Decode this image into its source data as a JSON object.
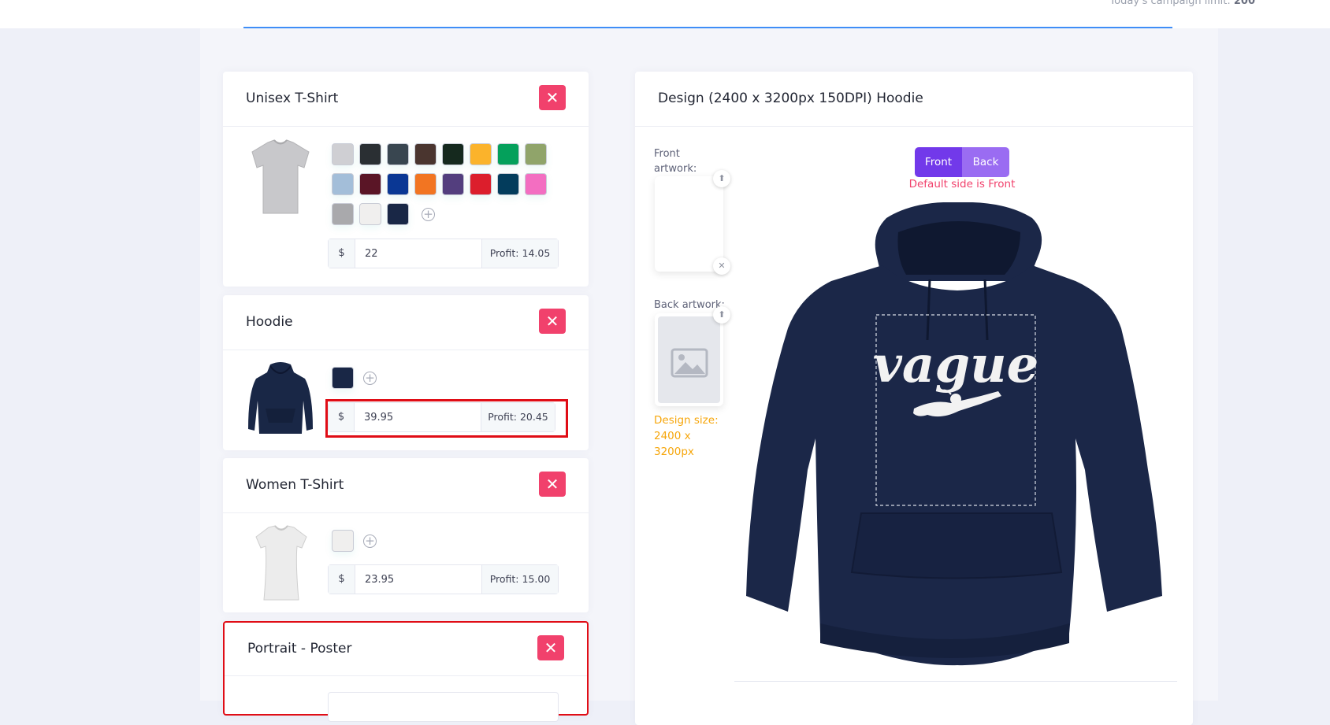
{
  "header": {
    "campaign_limit_label": "Today's campaign limit:",
    "campaign_limit_value": "200"
  },
  "products": [
    {
      "title": "Unisex T-Shirt",
      "currency": "$",
      "price": "22",
      "profit": "Profit: 14.05",
      "colors": [
        "#cfcfd3",
        "#2a2f33",
        "#394650",
        "#4a352f",
        "#15291e",
        "#fbb32b",
        "#04a05b",
        "#90a46a",
        "#a3bed9",
        "#5a1526",
        "#0a3794",
        "#f27522",
        "#533e7e",
        "#dc1e2c",
        "#033c5c",
        "#f36ec1",
        "#a9a9ac",
        "#f0efee",
        "#192746"
      ]
    },
    {
      "title": "Hoodie",
      "currency": "$",
      "price": "39.95",
      "profit": "Profit: 20.45",
      "colors": [
        "#192746"
      ]
    },
    {
      "title": "Women T-Shirt",
      "currency": "$",
      "price": "23.95",
      "profit": "Profit: 15.00",
      "colors": [
        "#f0efee"
      ]
    },
    {
      "title": "Portrait - Poster"
    }
  ],
  "design": {
    "title": "Design (2400 x 3200px 150DPI) Hoodie",
    "front_artwork_label": "Front artwork:",
    "back_artwork_label": "Back artwork:",
    "side_front": "Front",
    "side_back": "Back",
    "default_side": "Default side is Front",
    "design_size_line1": "Design size:",
    "design_size_line2": "2400 x",
    "design_size_line3": "3200px",
    "artwork_text": "vague",
    "garment_color": "#192746"
  }
}
